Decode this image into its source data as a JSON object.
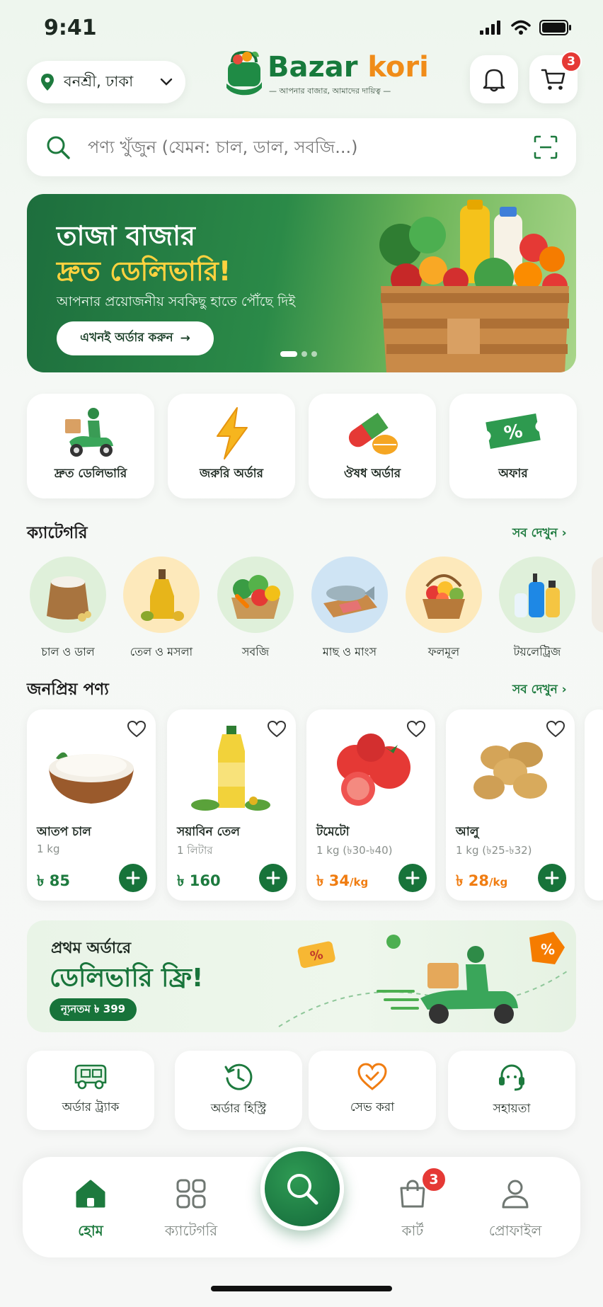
{
  "status_bar": {
    "time": "9:41"
  },
  "header": {
    "location": "বনশ্রী, ঢাকা",
    "brand_part1": "Bazar ",
    "brand_part2": "kori",
    "brand_tagline": "আপনার বাজার, আমাদের দায়িত্ব",
    "cart_count": "3"
  },
  "search": {
    "placeholder": "পণ্য খুঁজুন (যেমন: চাল, ডাল, সবজি...)"
  },
  "banner": {
    "title_line1": "তাজা বাজার",
    "title_line2": "দ্রুত ডেলিভারি!",
    "subtitle": "আপনার প্রয়োজনীয় সবকিছু হাতে পৌঁছে দিই",
    "cta": "এখনই অর্ডার করুন",
    "cta_arrow": "→"
  },
  "services": [
    {
      "label": "দ্রুত ডেলিভারি",
      "icon": "scooter-delivery-icon"
    },
    {
      "label": "জরুরি অর্ডার",
      "icon": "lightning-icon"
    },
    {
      "label": "ঔষধ অর্ডার",
      "icon": "pill-icon"
    },
    {
      "label": "অফার",
      "icon": "discount-ticket-icon"
    }
  ],
  "categories_section": {
    "title": "ক্যাটেগরি",
    "see_all": "সব দেখুন ›",
    "items": [
      {
        "label": "চাল ও ডাল",
        "icon": "rice-sack-icon"
      },
      {
        "label": "তেল ও মসলা",
        "icon": "oil-bottle-icon"
      },
      {
        "label": "সবজি",
        "icon": "vegetables-icon"
      },
      {
        "label": "মাছ ও মাংস",
        "icon": "fish-meat-icon"
      },
      {
        "label": "ফলমূল",
        "icon": "fruit-basket-icon"
      },
      {
        "label": "টয়লেট্রিজ",
        "icon": "toiletries-icon"
      }
    ]
  },
  "popular_section": {
    "title": "জনপ্রিয় পণ্য",
    "see_all": "সব দেখুন ›",
    "products": [
      {
        "name": "আতপ চাল",
        "unit": "1 kg",
        "price": "৳ 85",
        "icon": "rice-bowl-icon"
      },
      {
        "name": "সয়াবিন তেল",
        "unit": "1 লিটার",
        "price": "৳ 160",
        "icon": "oil-bottle-icon"
      },
      {
        "name": "টমেটো",
        "unit": "1 kg (৳30-৳40)",
        "price": "৳ 34",
        "price_unit": "/kg",
        "icon": "tomato-icon"
      },
      {
        "name": "আলু",
        "unit": "1 kg (৳25-৳32)",
        "price": "৳ 28",
        "price_unit": "/kg",
        "icon": "potato-icon"
      }
    ]
  },
  "promo": {
    "line1": "প্রথম অর্ডারে",
    "line2": "ডেলিভারি ফ্রি!",
    "minimum": "ন্যূনতম ৳ 399"
  },
  "utilities": [
    {
      "label": "অর্ডার ট্র্যাক",
      "icon": "truck-icon"
    },
    {
      "label": "অর্ডার হিস্ট্রি",
      "icon": "history-icon"
    },
    {
      "label": "সেভ করা",
      "icon": "heart-icon"
    },
    {
      "label": "সহায়তা",
      "icon": "headset-icon"
    }
  ],
  "bottom_nav": {
    "home": "হোম",
    "categories": "ক্যাটেগরি",
    "cart": "কার্ট",
    "profile": "প্রোফাইল",
    "cart_count": "3"
  },
  "colors": {
    "primary": "#17733a",
    "accent": "#f08c19",
    "badge": "#e53935"
  }
}
